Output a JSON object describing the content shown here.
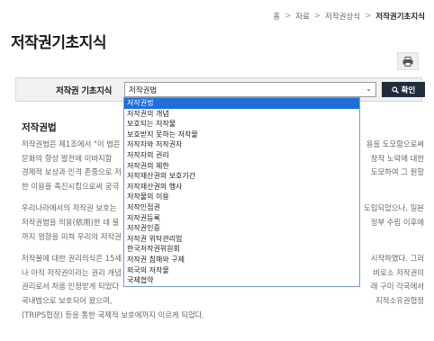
{
  "breadcrumb": [
    "홈",
    "자료",
    "저작권상식",
    "저작권기초지식"
  ],
  "breadcrumb_sep": ">",
  "page_title": "저작권기초지식",
  "print_icon": "printer-icon",
  "search": {
    "label": "저작권 기초지식",
    "selected": "저작권법",
    "button_label": "확인"
  },
  "dropdown_options": [
    "저작권법",
    "저작권의 개념",
    "보호되는 저작물",
    "보호받지 못하는 저작물",
    "저작자와 저작권자",
    "저작자의 권리",
    "저작권의 제한",
    "저작재산권의 보호기간",
    "저작재산권의 행사",
    "저작물의 이용",
    "저작인접권",
    "저작권등록",
    "저작권인증",
    "저작권 위탁관리업",
    "한국저작권위원회",
    "저작권 침해와 구제",
    "외국의 저작물",
    "국제협약"
  ],
  "section_title": "저작권법",
  "paragraphs": [
    [
      "저작권법은 제1조에서 \"이 법은",
      "문화의 향상 발전에 이바지함",
      "경제적 보상과 인격 존중으로 저",
      "한 이용을 촉진시킴으로써 궁극"
    ],
    [
      "우리나라에서의 저작권 보호는",
      "저작권법을 의용(依用)한 데 불",
      "까지 영향을 미쳐 우리의 저작권"
    ],
    [
      "저작물에 대한 권리의식은 15세",
      "나 아직 저작권이라는 권리 개념",
      "권리로서 처음 인정받게 되었다",
      "국내법으로 보호되어 왔으며,",
      "(TRIPS협정) 등을 통한 국제적 보호에까지 이르게 되었다."
    ]
  ],
  "right_fragments": [
    "용을 도모함으로써",
    "창작 노력에 대한",
    "도모하여 그 원할",
    "도입되었으나, 일본",
    "정부 수립 이후에",
    "시작하였다. 그러",
    "비로소 저작권이",
    "래 구미 각국에서",
    "지적소유권협정"
  ]
}
